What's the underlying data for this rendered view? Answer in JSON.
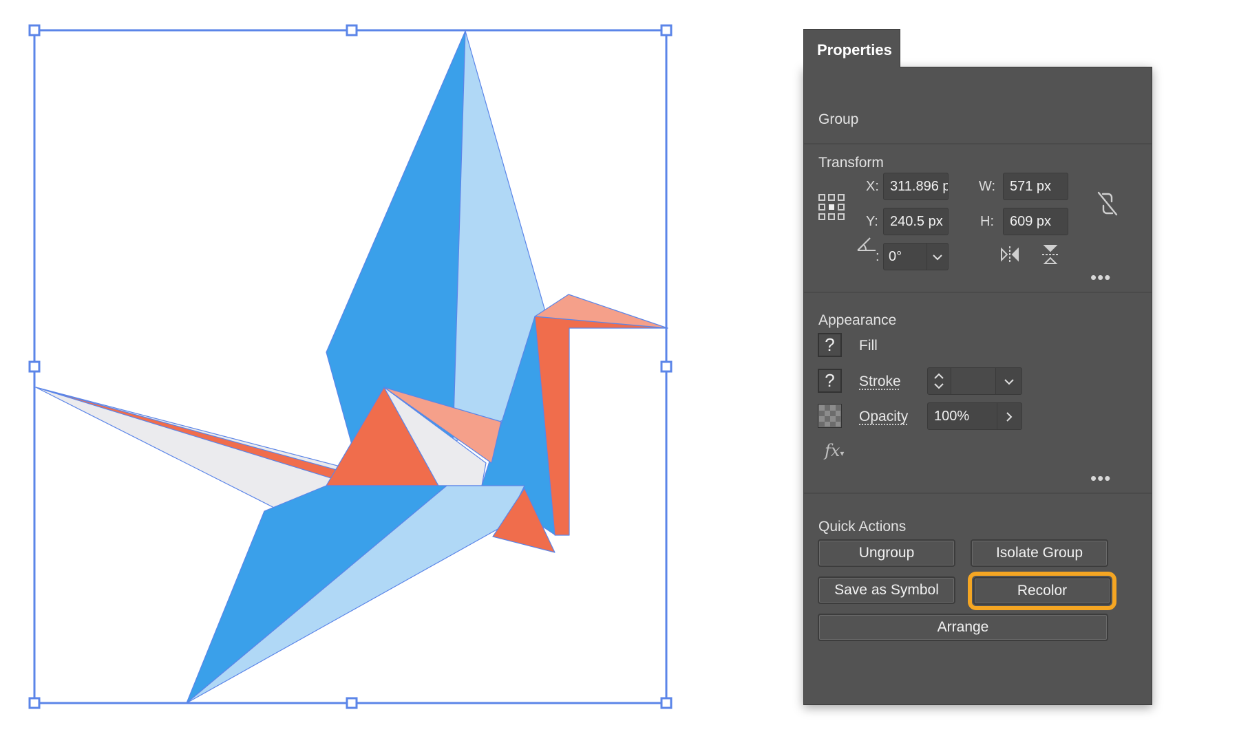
{
  "panel": {
    "tab_label": "Properties",
    "selection_type": "Group"
  },
  "transform": {
    "title": "Transform",
    "x_label": "X:",
    "x_value": "311.896 p",
    "y_label": "Y:",
    "y_value": "240.5 px",
    "w_label": "W:",
    "w_value": "571 px",
    "h_label": "H:",
    "h_value": "609 px",
    "angle_label": ":",
    "angle_value": "0°",
    "icons": [
      "reference-point-icon",
      "constrain-proportions-icon",
      "angle-icon",
      "flip-horizontal-icon",
      "flip-vertical-icon",
      "more-options-icon"
    ]
  },
  "appearance": {
    "title": "Appearance",
    "fill_label": "Fill",
    "fill_swatch": "?",
    "stroke_label": "Stroke",
    "stroke_swatch": "?",
    "opacity_label": "Opacity",
    "opacity_value": "100%",
    "fx_label": "fx"
  },
  "quick_actions": {
    "title": "Quick Actions",
    "ungroup": "Ungroup",
    "isolate_group": "Isolate Group",
    "save_as_symbol": "Save as Symbol",
    "recolor": "Recolor",
    "arrange": "Arrange",
    "highlight_color": "#f5a623"
  },
  "colors": {
    "panel_bg": "#535353",
    "selection_blue": "#5b85e8",
    "crane_blue": "#3aa0ea",
    "crane_light_blue": "#b0d8f6",
    "crane_orange": "#f06d4c",
    "crane_salmon": "#f5a08a",
    "crane_gray": "#ebebee"
  }
}
